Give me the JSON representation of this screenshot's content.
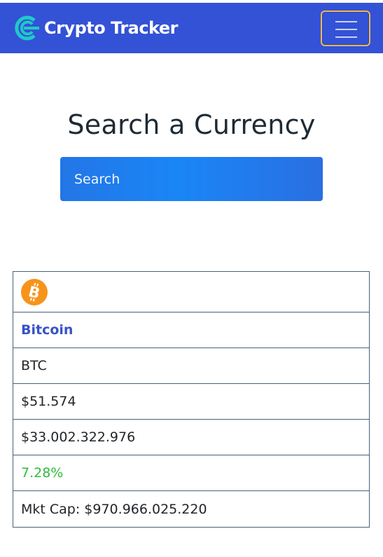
{
  "navbar": {
    "brand_text": "Crypto Tracker",
    "logo_icon": "crypto-tracker-logo-icon",
    "menu_icon": "hamburger-menu-icon",
    "background_color": "#3352d6",
    "logo_color": "#20c9c9",
    "toggle_border_color": "#f2b64f"
  },
  "main": {
    "title": "Search a Currency",
    "search": {
      "placeholder": "Search",
      "value": ""
    }
  },
  "coin": {
    "icon": "bitcoin-icon",
    "icon_color": "#f7931a",
    "name": "Bitcoin",
    "symbol": "BTC",
    "price": "$51.574",
    "volume": "$33.002.322.976",
    "change": "7.28%",
    "market_cap": "Mkt Cap: $970.966.025.220",
    "name_color": "#3952c6",
    "change_color": "#2ebd38"
  }
}
